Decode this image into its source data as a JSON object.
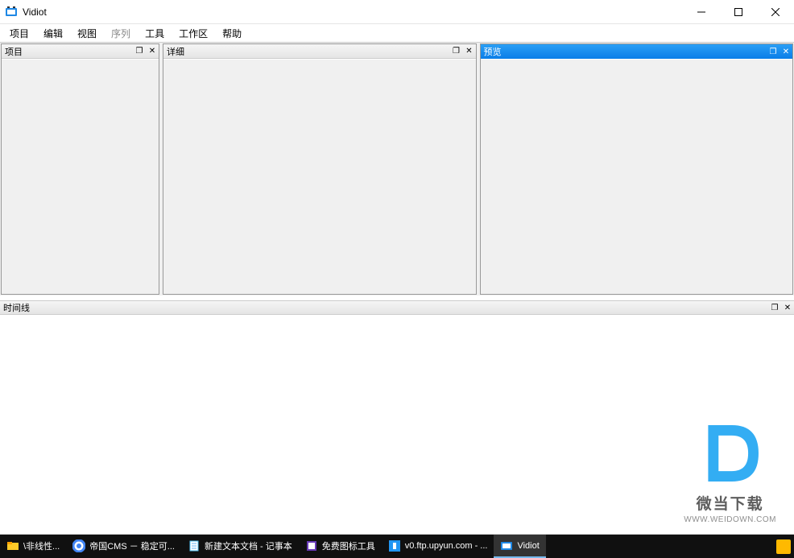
{
  "app": {
    "title": "Vidiot"
  },
  "menu": {
    "items": [
      "项目",
      "编辑",
      "视图",
      "序列",
      "工具",
      "工作区",
      "帮助"
    ],
    "disabled_index": 3
  },
  "panels": {
    "project": {
      "title": "项目"
    },
    "details": {
      "title": "详细"
    },
    "preview": {
      "title": "预览"
    },
    "timeline": {
      "title": "时间线"
    }
  },
  "taskbar": {
    "items": [
      {
        "label": "\\非线性...",
        "icon": "folder"
      },
      {
        "label": "帝国CMS － 稳定可...",
        "icon": "chrome"
      },
      {
        "label": "新建文本文档 - 记事本",
        "icon": "notepad"
      },
      {
        "label": "免费图标工具",
        "icon": "iconeditor"
      },
      {
        "label": "v0.ftp.upyun.com - ...",
        "icon": "filezilla"
      },
      {
        "label": "Vidiot",
        "icon": "vidiot",
        "active": true
      }
    ]
  },
  "watermark": {
    "name": "微当下载",
    "url": "WWW.WEIDOWN.COM"
  }
}
